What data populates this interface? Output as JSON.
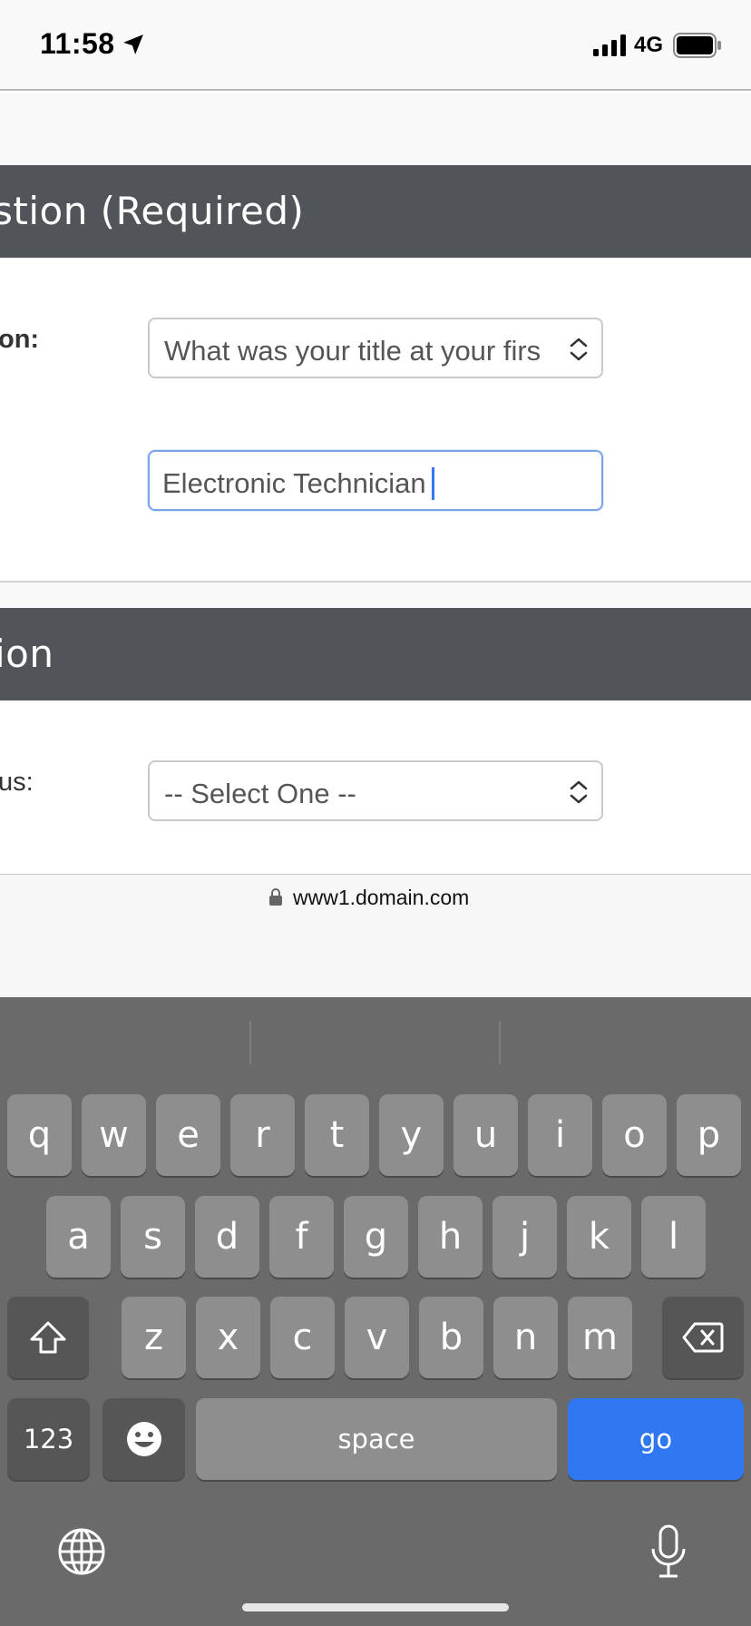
{
  "status_bar": {
    "time": "11:58",
    "network": "4G",
    "icons": [
      "location-arrow-icon",
      "signal-bars-icon",
      "battery-icon"
    ]
  },
  "sections": [
    {
      "header": "stion (Required)",
      "label": "on:",
      "select_value": "What was your title at your firs",
      "input_value": "Electronic Technician"
    },
    {
      "header": "ion",
      "label": "us:",
      "select_value": "-- Select One --"
    }
  ],
  "browser": {
    "url": "www1.domain.com"
  },
  "keyboard": {
    "row1": [
      "q",
      "w",
      "e",
      "r",
      "t",
      "y",
      "u",
      "i",
      "o",
      "p"
    ],
    "row2": [
      "a",
      "s",
      "d",
      "f",
      "g",
      "h",
      "j",
      "k",
      "l"
    ],
    "row3": [
      "z",
      "x",
      "c",
      "v",
      "b",
      "n",
      "m"
    ],
    "numbers_label": "123",
    "space_label": "space",
    "go_label": "go",
    "colors": {
      "go": "#2f78f2",
      "keys": "#8e8e8e",
      "background": "#6a6a6a"
    }
  }
}
